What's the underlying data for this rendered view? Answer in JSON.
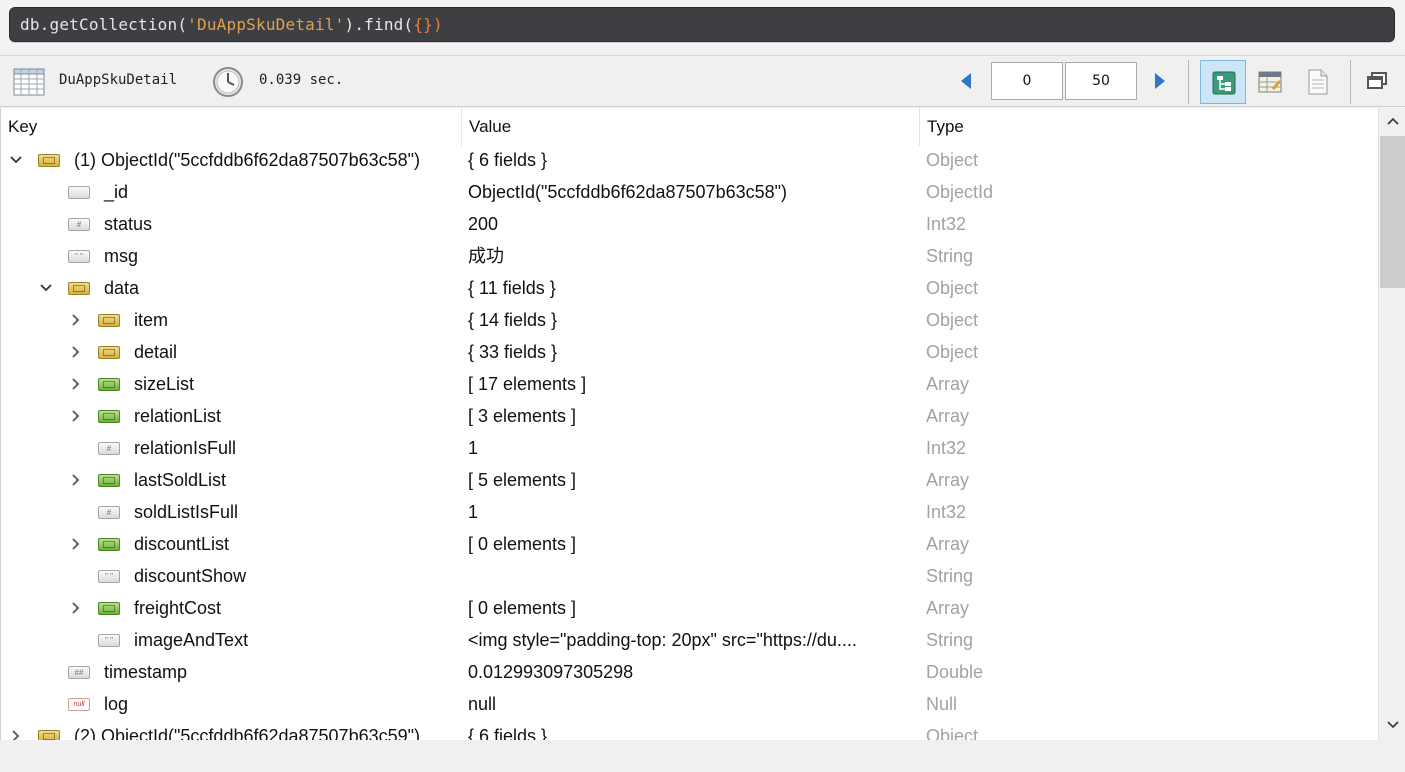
{
  "query": {
    "prefix": "db.getCollection(",
    "collection_literal": "'DuAppSkuDetail'",
    "mid": ").find(",
    "braces": "{}",
    "suffix": ")"
  },
  "toolbar": {
    "collection_icon": "table-grid-icon",
    "collection_name": "DuAppSkuDetail",
    "clock_icon": "clock-icon",
    "exec_time": "0.039 sec.",
    "skip_value": "0",
    "limit_value": "50",
    "prev_icon": "arrow-left-icon",
    "next_icon": "arrow-right-icon",
    "views": [
      "tree-view-icon",
      "table-view-icon",
      "text-view-icon"
    ],
    "active_view": "tree-view-icon",
    "window_icon": "maximize-window-icon",
    "accent_color": "#2e76c8"
  },
  "columns": {
    "key": "Key",
    "value": "Value",
    "type": "Type"
  },
  "rows": [
    {
      "depth": 0,
      "chevron": "down",
      "icon": "object",
      "key": "(1) ObjectId(\"5ccfddb6f62da87507b63c58\")",
      "value": "{ 6 fields }",
      "type": "Object"
    },
    {
      "depth": 1,
      "chevron": "none",
      "icon": "objectid",
      "key": "_id",
      "value": "ObjectId(\"5ccfddb6f62da87507b63c58\")",
      "type": "ObjectId"
    },
    {
      "depth": 1,
      "chevron": "none",
      "icon": "int",
      "key": "status",
      "value": "200",
      "type": "Int32"
    },
    {
      "depth": 1,
      "chevron": "none",
      "icon": "string",
      "key": "msg",
      "value": "成功",
      "type": "String"
    },
    {
      "depth": 1,
      "chevron": "down",
      "icon": "object",
      "key": "data",
      "value": "{ 11 fields }",
      "type": "Object"
    },
    {
      "depth": 2,
      "chevron": "right",
      "icon": "object",
      "key": "item",
      "value": "{ 14 fields }",
      "type": "Object"
    },
    {
      "depth": 2,
      "chevron": "right",
      "icon": "object",
      "key": "detail",
      "value": "{ 33 fields }",
      "type": "Object"
    },
    {
      "depth": 2,
      "chevron": "right",
      "icon": "array",
      "key": "sizeList",
      "value": "[ 17 elements ]",
      "type": "Array"
    },
    {
      "depth": 2,
      "chevron": "right",
      "icon": "array",
      "key": "relationList",
      "value": "[ 3 elements ]",
      "type": "Array"
    },
    {
      "depth": 2,
      "chevron": "none",
      "icon": "int",
      "key": "relationIsFull",
      "value": "1",
      "type": "Int32"
    },
    {
      "depth": 2,
      "chevron": "right",
      "icon": "array",
      "key": "lastSoldList",
      "value": "[ 5 elements ]",
      "type": "Array"
    },
    {
      "depth": 2,
      "chevron": "none",
      "icon": "int",
      "key": "soldListIsFull",
      "value": "1",
      "type": "Int32"
    },
    {
      "depth": 2,
      "chevron": "right",
      "icon": "array",
      "key": "discountList",
      "value": "[ 0 elements ]",
      "type": "Array"
    },
    {
      "depth": 2,
      "chevron": "none",
      "icon": "string",
      "key": "discountShow",
      "value": "",
      "type": "String"
    },
    {
      "depth": 2,
      "chevron": "right",
      "icon": "array",
      "key": "freightCost",
      "value": "[ 0 elements ]",
      "type": "Array"
    },
    {
      "depth": 2,
      "chevron": "none",
      "icon": "string",
      "key": "imageAndText",
      "value": "<img style=\"padding-top: 20px\" src=\"https://du....",
      "type": "String"
    },
    {
      "depth": 1,
      "chevron": "none",
      "icon": "double",
      "key": "timestamp",
      "value": "0.012993097305298",
      "type": "Double"
    },
    {
      "depth": 1,
      "chevron": "none",
      "icon": "null",
      "key": "log",
      "value": "null",
      "type": "Null"
    },
    {
      "depth": 0,
      "chevron": "right",
      "icon": "object",
      "key": "(2) ObjectId(\"5ccfddb6f62da87507b63c59\")",
      "value": "{ 6 fields }",
      "type": "Object"
    }
  ],
  "scrollbar": {
    "up_icon": "chevron-up-icon",
    "down_icon": "chevron-down-icon"
  }
}
